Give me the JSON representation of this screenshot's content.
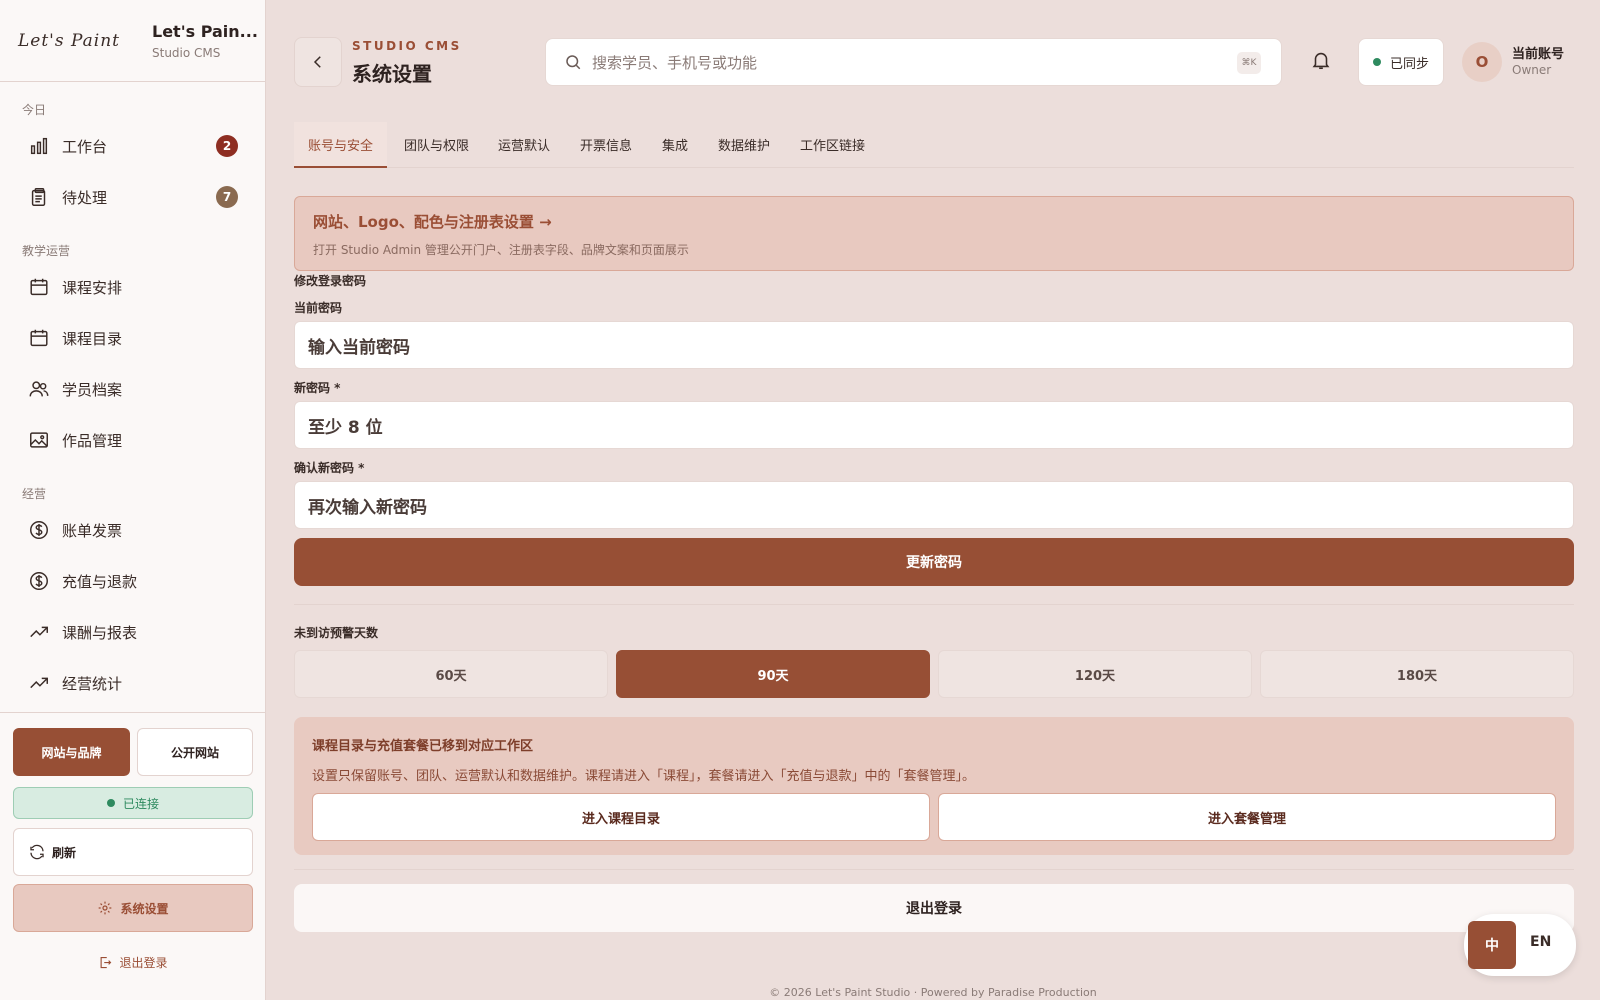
{
  "brand": {
    "logo": "Let's Paint",
    "name": "Let's Pain...",
    "sub": "Studio CMS"
  },
  "sidebar": {
    "groups": [
      {
        "label": "今日"
      },
      {
        "label": "教学运营"
      },
      {
        "label": "经营"
      }
    ],
    "items": [
      {
        "label": "工作台",
        "icon": "bar-chart-icon",
        "badge": "2",
        "badge_color": "#8e2e22"
      },
      {
        "label": "待处理",
        "icon": "clipboard-icon",
        "badge": "7",
        "badge_color": "#8a6a50"
      },
      {
        "label": "课程安排",
        "icon": "calendar-icon"
      },
      {
        "label": "课程目录",
        "icon": "calendar-icon"
      },
      {
        "label": "学员档案",
        "icon": "users-icon"
      },
      {
        "label": "作品管理",
        "icon": "image-icon"
      },
      {
        "label": "账单发票",
        "icon": "dollar-icon"
      },
      {
        "label": "充值与退款",
        "icon": "dollar-icon"
      },
      {
        "label": "课酬与报表",
        "icon": "trend-icon"
      },
      {
        "label": "经营统计",
        "icon": "trend-icon"
      }
    ],
    "website_brand_button": "网站与品牌",
    "public_site_button": "公开网站",
    "connection_status": "已连接",
    "refresh_button": "刷新",
    "settings_button": "系统设置",
    "logout_button": "退出登录"
  },
  "header": {
    "kicker": "STUDIO CMS",
    "title": "系统设置",
    "search_placeholder": "搜索学员、手机号或功能",
    "shortcut": "⌘K",
    "sync_status": "已同步",
    "avatar_initial": "O",
    "account_name": "当前账号",
    "account_role": "Owner"
  },
  "tabs": [
    {
      "label": "账号与安全",
      "active": true
    },
    {
      "label": "团队与权限"
    },
    {
      "label": "运营默认"
    },
    {
      "label": "开票信息"
    },
    {
      "label": "集成"
    },
    {
      "label": "数据维护"
    },
    {
      "label": "工作区链接"
    }
  ],
  "banner": {
    "title": "网站、Logo、配色与注册表设置 →",
    "desc": "打开 Studio Admin 管理公开门户、注册表字段、品牌文案和页面展示"
  },
  "password": {
    "section_title": "修改登录密码",
    "current_label": "当前密码",
    "current_placeholder": "输入当前密码",
    "new_label": "新密码 *",
    "new_placeholder": "至少 8 位",
    "confirm_label": "确认新密码 *",
    "confirm_placeholder": "再次输入新密码",
    "submit": "更新密码"
  },
  "visit_warning": {
    "label": "未到访预警天数",
    "options": [
      "60天",
      "90天",
      "120天",
      "180天"
    ],
    "selected": "90天"
  },
  "notice": {
    "title": "课程目录与充值套餐已移到对应工作区",
    "desc": "设置只保留账号、团队、运营默认和数据维护。课程请进入「课程」，套餐请进入「充值与退款」中的「套餐管理」。",
    "course_button": "进入课程目录",
    "package_button": "进入套餐管理"
  },
  "logout": "退出登录",
  "footer": "© 2026 Let's Paint Studio · Powered by Paradise Production",
  "lang": {
    "zh": "中",
    "en": "EN"
  },
  "colors": {
    "accent": "#974f35",
    "background": "#ecdedb",
    "success": "#2e8a5f"
  }
}
